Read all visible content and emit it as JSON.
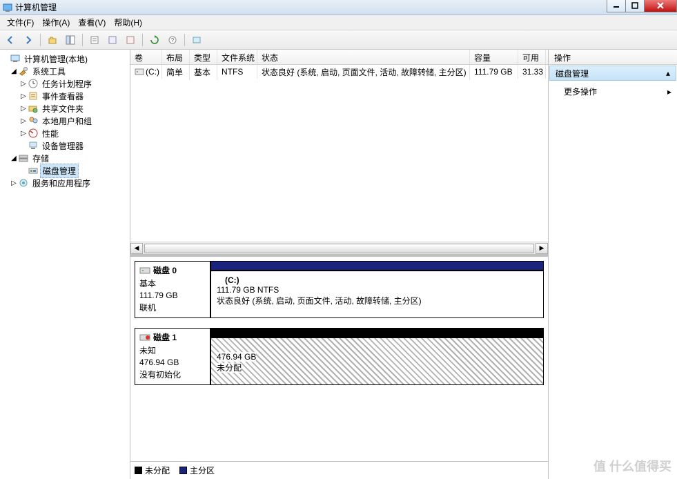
{
  "window": {
    "title": "计算机管理"
  },
  "menu": {
    "file": "文件(F)",
    "action": "操作(A)",
    "view": "查看(V)",
    "help": "帮助(H)"
  },
  "tree": {
    "root": "计算机管理(本地)",
    "system_tools": "系统工具",
    "task_scheduler": "任务计划程序",
    "event_viewer": "事件查看器",
    "shared_folders": "共享文件夹",
    "local_users": "本地用户和组",
    "performance": "性能",
    "device_manager": "设备管理器",
    "storage": "存储",
    "disk_management": "磁盘管理",
    "services_apps": "服务和应用程序"
  },
  "columns": {
    "volume": "卷",
    "layout": "布局",
    "type": "类型",
    "filesystem": "文件系统",
    "status": "状态",
    "capacity": "容量",
    "free": "可用"
  },
  "volumes": [
    {
      "name": "(C:)",
      "layout": "简单",
      "type": "基本",
      "fs": "NTFS",
      "status": "状态良好 (系统, 启动, 页面文件, 活动, 故障转储, 主分区)",
      "capacity": "111.79 GB",
      "free": "31.33"
    }
  ],
  "disks": [
    {
      "name": "磁盘 0",
      "kind": "基本",
      "size": "111.79 GB",
      "state": "联机",
      "bar_color": "#1a237e",
      "partition": {
        "label": "(C:)",
        "line2": "111.79 GB NTFS",
        "line3": "状态良好 (系统, 启动, 页面文件, 活动, 故障转储, 主分区)",
        "hatched": false
      }
    },
    {
      "name": "磁盘 1",
      "kind": "未知",
      "size": "476.94 GB",
      "state": "没有初始化",
      "bar_color": "#000000",
      "partition": {
        "label": "",
        "line2": "476.94 GB",
        "line3": "未分配",
        "hatched": true
      }
    }
  ],
  "legend": {
    "unallocated": "未分配",
    "primary": "主分区"
  },
  "actions": {
    "header": "操作",
    "section": "磁盘管理",
    "more": "更多操作"
  },
  "watermark": "值 什么值得买"
}
